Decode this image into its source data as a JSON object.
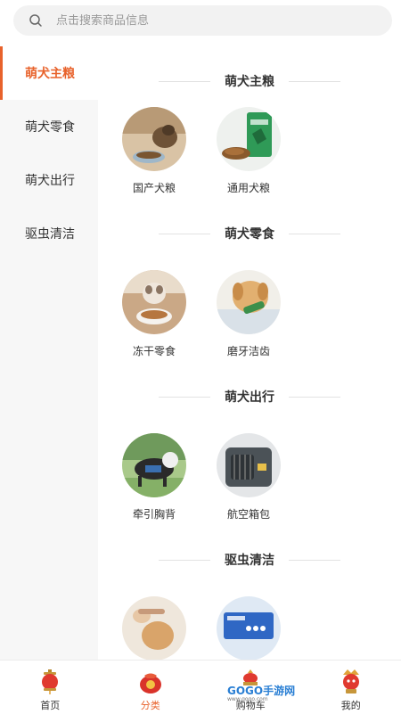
{
  "search": {
    "placeholder": "点击搜索商品信息"
  },
  "sidebar": {
    "items": [
      {
        "label": "萌犬主粮",
        "active": true
      },
      {
        "label": "萌犬零食",
        "active": false
      },
      {
        "label": "萌犬出行",
        "active": false
      },
      {
        "label": "驱虫清洁",
        "active": false
      }
    ]
  },
  "sections": [
    {
      "title": "萌犬主粮",
      "items": [
        {
          "label": "国产犬粮"
        },
        {
          "label": "通用犬粮"
        }
      ]
    },
    {
      "title": "萌犬零食",
      "items": [
        {
          "label": "冻干零食"
        },
        {
          "label": "磨牙洁齿"
        }
      ]
    },
    {
      "title": "萌犬出行",
      "items": [
        {
          "label": "牵引胸背"
        },
        {
          "label": "航空箱包"
        }
      ]
    },
    {
      "title": "驱虫清洁",
      "items": [
        {
          "label": ""
        },
        {
          "label": ""
        }
      ]
    }
  ],
  "tabbar": {
    "tabs": [
      {
        "label": "首页",
        "icon": "lantern-icon"
      },
      {
        "label": "分类",
        "icon": "lucky-bag-icon",
        "active": true
      },
      {
        "label": "购物车",
        "icon": "cart-lantern-icon"
      },
      {
        "label": "我的",
        "icon": "mascot-icon"
      }
    ]
  },
  "watermark": {
    "brand": "GOGO手游网",
    "sub": "www.gogo.com"
  },
  "colors": {
    "accent": "#e8622b",
    "sidebar_bg": "#f7f7f7",
    "search_bg": "#f2f2f2"
  }
}
